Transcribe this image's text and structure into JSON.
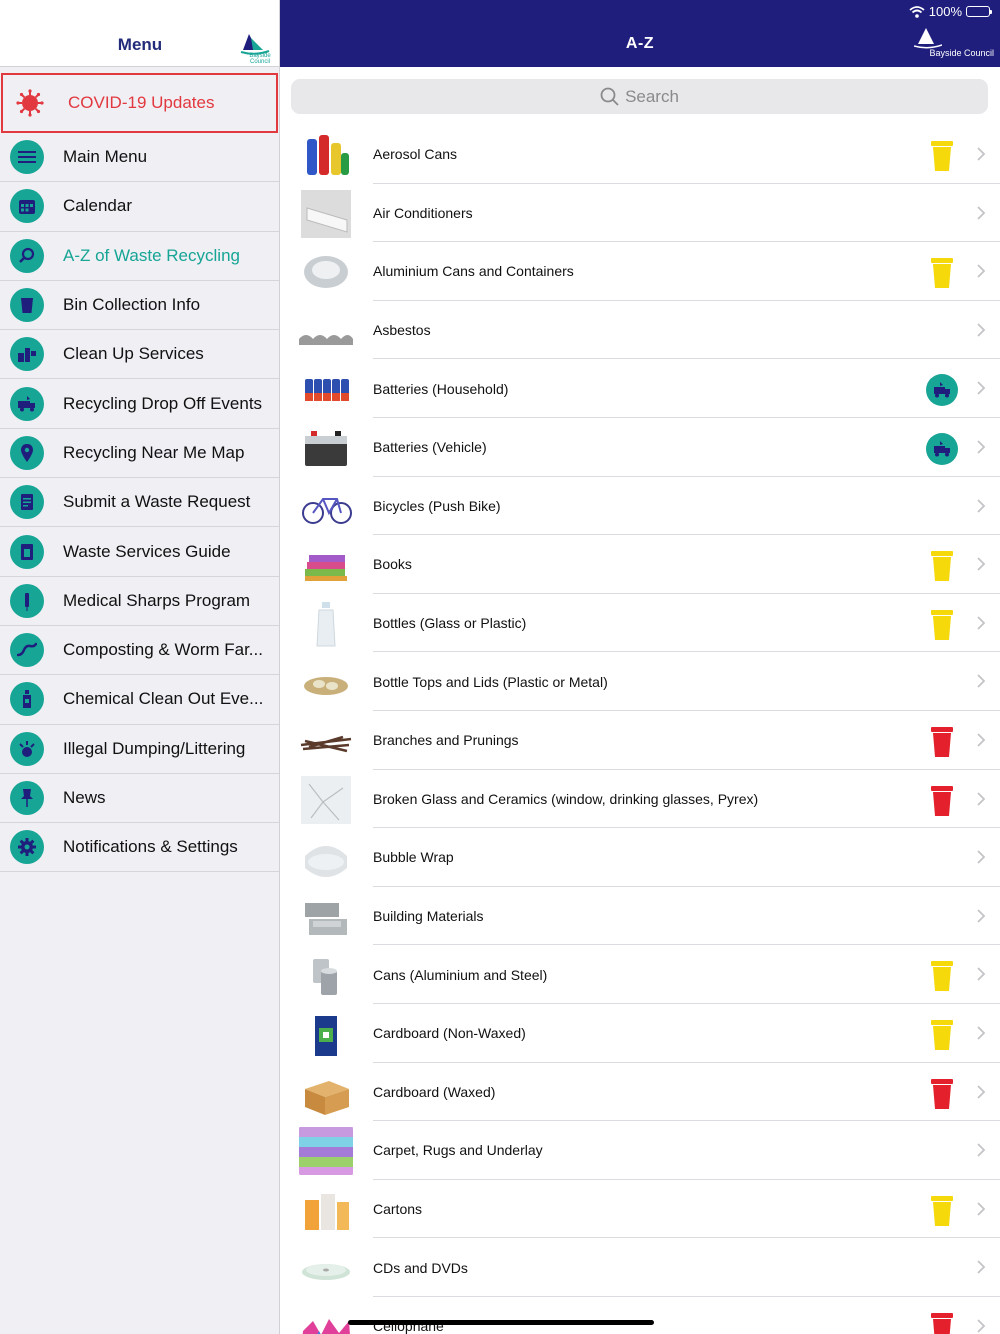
{
  "sidebar": {
    "title": "Menu",
    "logo_text": "Bayside Council",
    "items": [
      {
        "label": "COVID-19 Updates",
        "icon": "virus-icon",
        "style": "covid"
      },
      {
        "label": "Main Menu",
        "icon": "menu-lines-icon"
      },
      {
        "label": "Calendar",
        "icon": "calendar-icon"
      },
      {
        "label": "A-Z of Waste Recycling",
        "icon": "search-icon",
        "style": "active"
      },
      {
        "label": "Bin Collection Info",
        "icon": "bin-icon"
      },
      {
        "label": "Clean Up Services",
        "icon": "clean-up-icon"
      },
      {
        "label": "Recycling Drop Off Events",
        "icon": "recycle-truck-icon"
      },
      {
        "label": "Recycling Near Me Map",
        "icon": "map-pin-icon"
      },
      {
        "label": "Submit a Waste Request",
        "icon": "form-icon"
      },
      {
        "label": "Waste Services Guide",
        "icon": "guide-icon"
      },
      {
        "label": "Medical Sharps Program",
        "icon": "sharps-icon"
      },
      {
        "label": "Composting & Worm Far...",
        "icon": "worm-icon"
      },
      {
        "label": "Chemical Clean Out Eve...",
        "icon": "chemical-bottle-icon"
      },
      {
        "label": "Illegal Dumping/Littering",
        "icon": "dumping-icon"
      },
      {
        "label": "News",
        "icon": "pin-icon"
      },
      {
        "label": "Notifications & Settings",
        "icon": "gear-icon"
      }
    ]
  },
  "header": {
    "title": "A-Z",
    "battery": "100%",
    "brand": "Bayside Council"
  },
  "search": {
    "placeholder": "Search"
  },
  "colors": {
    "yellow_bin": "#f5d90a",
    "red_bin": "#e4202c",
    "teal": "#17a596",
    "navy": "#1f1e7d"
  },
  "items": [
    {
      "label": "Aerosol Cans",
      "bin": "yellow",
      "thumb": "aerosol-cans-thumb"
    },
    {
      "label": "Air Conditioners",
      "bin": "",
      "thumb": "air-conditioner-thumb"
    },
    {
      "label": "Aluminium Cans and Containers",
      "bin": "yellow",
      "thumb": "aluminium-foil-thumb"
    },
    {
      "label": "Asbestos",
      "bin": "",
      "thumb": "asbestos-thumb"
    },
    {
      "label": "Batteries (Household)",
      "bin": "dropoff",
      "thumb": "household-batteries-thumb"
    },
    {
      "label": "Batteries (Vehicle)",
      "bin": "dropoff",
      "thumb": "vehicle-battery-thumb"
    },
    {
      "label": "Bicycles (Push Bike)",
      "bin": "",
      "thumb": "bicycle-thumb"
    },
    {
      "label": "Books",
      "bin": "yellow",
      "thumb": "books-thumb"
    },
    {
      "label": "Bottles (Glass or Plastic)",
      "bin": "yellow",
      "thumb": "bottle-thumb"
    },
    {
      "label": "Bottle Tops and Lids (Plastic or Metal)",
      "bin": "",
      "thumb": "bottle-tops-thumb"
    },
    {
      "label": "Branches and Prunings",
      "bin": "red",
      "thumb": "branches-thumb"
    },
    {
      "label": "Broken Glass and Ceramics (window, drinking glasses, Pyrex)",
      "bin": "red",
      "thumb": "broken-glass-thumb"
    },
    {
      "label": "Bubble Wrap",
      "bin": "",
      "thumb": "bubble-wrap-thumb"
    },
    {
      "label": "Building Materials",
      "bin": "",
      "thumb": "building-materials-thumb"
    },
    {
      "label": "Cans (Aluminium and Steel)",
      "bin": "yellow",
      "thumb": "cans-thumb"
    },
    {
      "label": "Cardboard (Non-Waxed)",
      "bin": "yellow",
      "thumb": "cardboard-box-thumb"
    },
    {
      "label": "Cardboard (Waxed)",
      "bin": "red",
      "thumb": "waxed-box-thumb"
    },
    {
      "label": "Carpet, Rugs and Underlay",
      "bin": "",
      "thumb": "carpet-thumb"
    },
    {
      "label": "Cartons",
      "bin": "yellow",
      "thumb": "cartons-thumb"
    },
    {
      "label": "CDs and DVDs",
      "bin": "",
      "thumb": "cds-thumb"
    },
    {
      "label": "Cellophane",
      "bin": "red",
      "thumb": "cellophane-thumb"
    }
  ]
}
